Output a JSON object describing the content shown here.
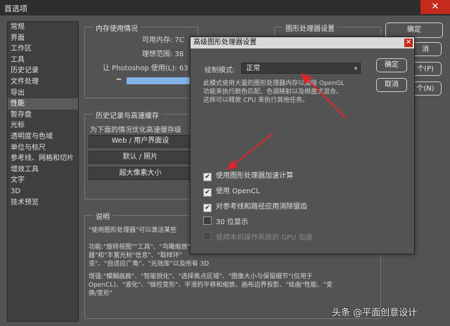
{
  "window": {
    "title": "首选项",
    "close": "✕"
  },
  "sidebar": {
    "items": [
      "常规",
      "界面",
      "工作区",
      "工具",
      "历史记录",
      "文件处理",
      "导出",
      "性能",
      "暂存盘",
      "光标",
      "透明度与色域",
      "单位与标尺",
      "参考线、网格和切片",
      "增效工具",
      "文字",
      "3D",
      "技术预览"
    ],
    "selected": 7
  },
  "memory": {
    "title": "内存使用情况",
    "available": "可用内存: 7C",
    "ideal": "理想范围: 38",
    "let": "让 Photoshop 使用(L): 63",
    "slider_fill_fraction": 1.0,
    "slider_knob": "━"
  },
  "history": {
    "title": "历史记录与高速缓存",
    "hint": "为下面的情况优化高速缓存级",
    "presets": [
      "Web / 用户界面设",
      "默认 / 照片",
      "超大像素大小"
    ]
  },
  "gpu_panel": {
    "title": "图形处理器设置"
  },
  "description": {
    "title": "说明",
    "p1": "\"使用图形处理器\"可以激活某些",
    "p2": "功能:\"旋转视图\"\"工具\"、\"鸟瞰缩放\"",
    "p3": "器\"和\"丰富光标\"信息\"、\"取样环\"",
    "p4": "览\"、\"自适应广角\"、\"光效库\"以及所有 3D",
    "p5": "增强:\"模糊画廊\"、\"智能锐化\"、\"选择焦点区域\"、\"图像大小与保留细节\"(仅用于",
    "p6": "OpenCL)、\"液化\"、\"操控变形\"、平滑的平移和缩放、画布边界投影、\"绘画\"性能、\"变",
    "p7": "换/变形\""
  },
  "right_buttons": {
    "ok": "确定",
    "cancel": "消",
    "prev": "个(P)",
    "next": "个(N)"
  },
  "dialog": {
    "title": "高级图形处理器设置",
    "mode_label": "绘制模式:",
    "mode_value": "正常",
    "desc1": "此模式使用大量的图形处理器内存以高级 OpenGL",
    "desc2": "功能来执行颜色匹配、色调映射以及棋盘式混合。",
    "desc3": "这样可以释放 CPU 来执行其他任务。",
    "ok": "确定",
    "cancel": "取消",
    "checks": [
      {
        "label": "使用图形处理器加速计算",
        "checked": true
      },
      {
        "label": "使用 OpenCL",
        "checked": true
      },
      {
        "label": "对参考线和路径应用消除锯齿",
        "checked": true
      },
      {
        "label": "30 位显示",
        "checked": false
      },
      {
        "label": "使用本机操作系统的 GPU 加速",
        "checked": false,
        "disabled": true
      }
    ],
    "arrow_color": "#e0262b"
  },
  "watermark": "头条 @平面创意设计"
}
